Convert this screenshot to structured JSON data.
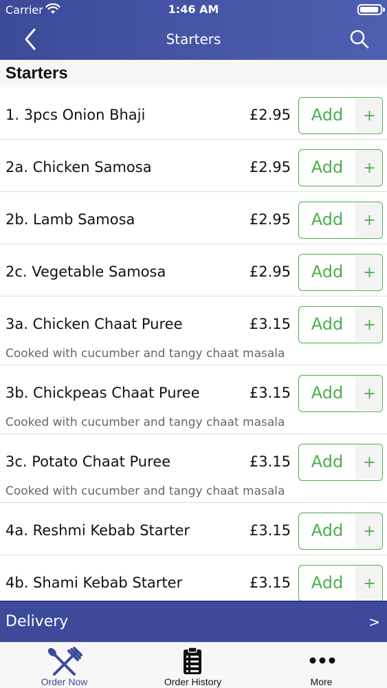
{
  "status_bar": {
    "carrier": "Carrier",
    "time": "1:46 AM"
  },
  "nav": {
    "title": "Starters"
  },
  "section": {
    "title": "Starters"
  },
  "items": [
    {
      "name": "1. 3pcs Onion Bhaji",
      "price": "£2.95",
      "description": "",
      "add_label": "Add",
      "plus": "+"
    },
    {
      "name": "2a. Chicken Samosa",
      "price": "£2.95",
      "description": "",
      "add_label": "Add",
      "plus": "+"
    },
    {
      "name": "2b. Lamb Samosa",
      "price": "£2.95",
      "description": "",
      "add_label": "Add",
      "plus": "+"
    },
    {
      "name": "2c. Vegetable Samosa",
      "price": "£2.95",
      "description": "",
      "add_label": "Add",
      "plus": "+"
    },
    {
      "name": "3a. Chicken Chaat Puree",
      "price": "£3.15",
      "description": "Cooked with cucumber and tangy chaat masala",
      "add_label": "Add",
      "plus": "+"
    },
    {
      "name": "3b. Chickpeas Chaat Puree",
      "price": "£3.15",
      "description": "Cooked with cucumber and tangy chaat masala",
      "add_label": "Add",
      "plus": "+"
    },
    {
      "name": "3c. Potato Chaat Puree",
      "price": "£3.15",
      "description": "Cooked with cucumber and tangy chaat masala",
      "add_label": "Add",
      "plus": "+"
    },
    {
      "name": "4a. Reshmi Kebab Starter",
      "price": "£3.15",
      "description": "",
      "add_label": "Add",
      "plus": "+"
    },
    {
      "name": "4b. Shami Kebab Starter",
      "price": "£3.15",
      "description": "",
      "add_label": "Add",
      "plus": "+"
    }
  ],
  "delivery": {
    "label": "Delivery",
    "arrow": ">"
  },
  "tabs": [
    {
      "label": "Order Now",
      "icon": "fork-knife-icon",
      "active": true
    },
    {
      "label": "Order History",
      "icon": "clipboard-list-icon",
      "active": false
    },
    {
      "label": "More",
      "icon": "more-dots-icon",
      "active": false
    }
  ],
  "colors": {
    "nav_bar": "#3c4a9a",
    "accent_green": "#4cae4c",
    "tab_active": "#3c4a9a"
  }
}
